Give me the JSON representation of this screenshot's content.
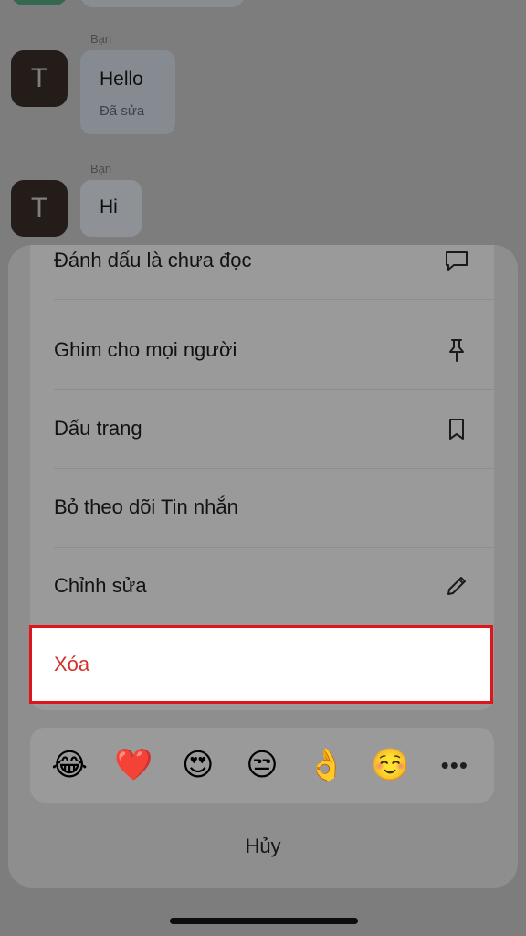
{
  "chat": {
    "messages": [
      {
        "sender": "Bạn",
        "avatar_letter": "T",
        "text": "Hello",
        "edited_label": "Đã sửa"
      },
      {
        "sender": "Bạn",
        "avatar_letter": "T",
        "text": "Hi"
      }
    ]
  },
  "action_sheet": {
    "items": [
      {
        "label": "Đánh dấu là chưa đọc",
        "icon": "speech-bubble-icon"
      },
      {
        "label": "Ghim cho mọi người",
        "icon": "pin-icon"
      },
      {
        "label": "Dấu trang",
        "icon": "bookmark-icon"
      },
      {
        "label": "Bỏ theo dõi Tin nhắn",
        "icon": ""
      },
      {
        "label": "Chỉnh sửa",
        "icon": "pencil-icon"
      }
    ],
    "delete_label": "Xóa",
    "reactions": [
      "😂",
      "❤️",
      "😍",
      "😒",
      "👌",
      "☺️"
    ],
    "more_label": "•••",
    "cancel_label": "Hủy"
  },
  "colors": {
    "highlight_border": "#e0151c",
    "delete_text": "#d4302b"
  }
}
